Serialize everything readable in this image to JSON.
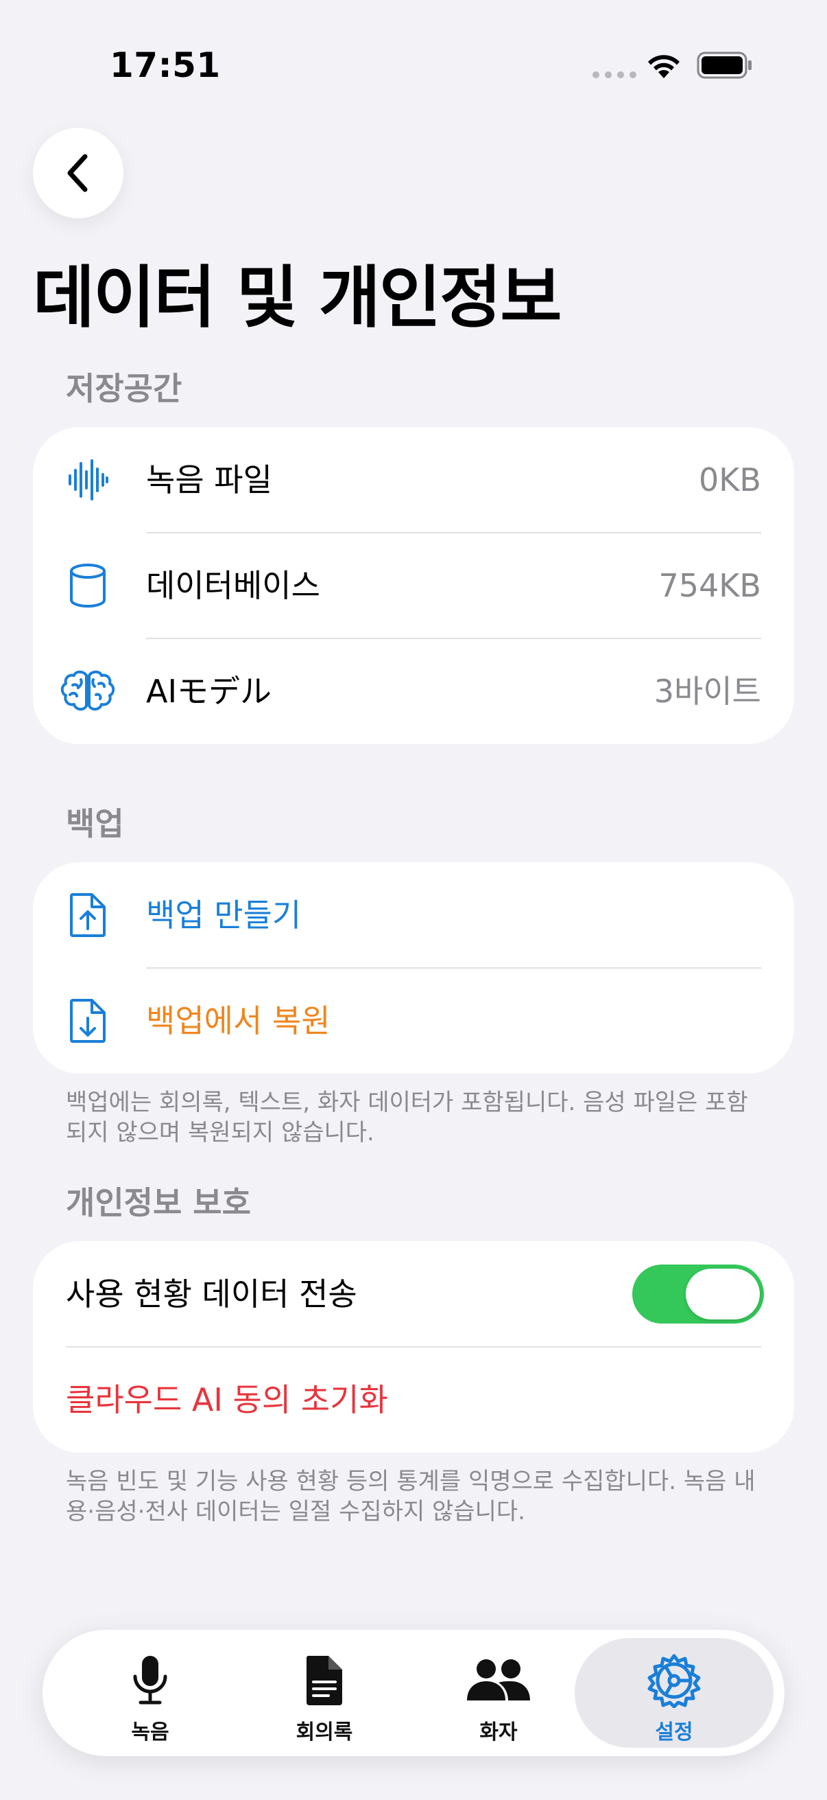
{
  "status_bar": {
    "time": "17:51"
  },
  "page": {
    "title": "데이터 및 개인정보"
  },
  "storage": {
    "header": "저장공간",
    "rows": [
      {
        "label": "녹음 파일",
        "value": "0KB",
        "icon": "waveform-icon"
      },
      {
        "label": "데이터베이스",
        "value": "754KB",
        "icon": "database-icon"
      },
      {
        "label": "AIモデル",
        "value": "3바이트",
        "icon": "brain-icon"
      }
    ]
  },
  "backup": {
    "header": "백업",
    "create_label": "백업 만들기",
    "restore_label": "백업에서 복원",
    "footnote": "백업에는 회의록, 텍스트, 화자 데이터가 포함됩니다. 음성 파일은 포함되지 않으며 복원되지 않습니다."
  },
  "privacy": {
    "header": "개인정보 보호",
    "usage_label": "사용 현황 데이터 전송",
    "usage_enabled": true,
    "reset_label": "클라우드 AI 동의 초기화",
    "footnote": "녹음 빈도 및 기능 사용 현황 등의 통계를 익명으로 수집합니다. 녹음 내용·음성·전사 데이터는 일절 수집하지 않습니다."
  },
  "tabs": [
    {
      "label": "녹음",
      "icon": "microphone-icon",
      "active": false
    },
    {
      "label": "회의록",
      "icon": "document-icon",
      "active": false
    },
    {
      "label": "화자",
      "icon": "people-icon",
      "active": false
    },
    {
      "label": "설정",
      "icon": "gear-icon",
      "active": true
    }
  ],
  "colors": {
    "accent_blue": "#1a7fd8",
    "accent_orange": "#f0861e",
    "destructive_red": "#e8343c",
    "toggle_green": "#34c759",
    "background": "#f2f2f7"
  }
}
